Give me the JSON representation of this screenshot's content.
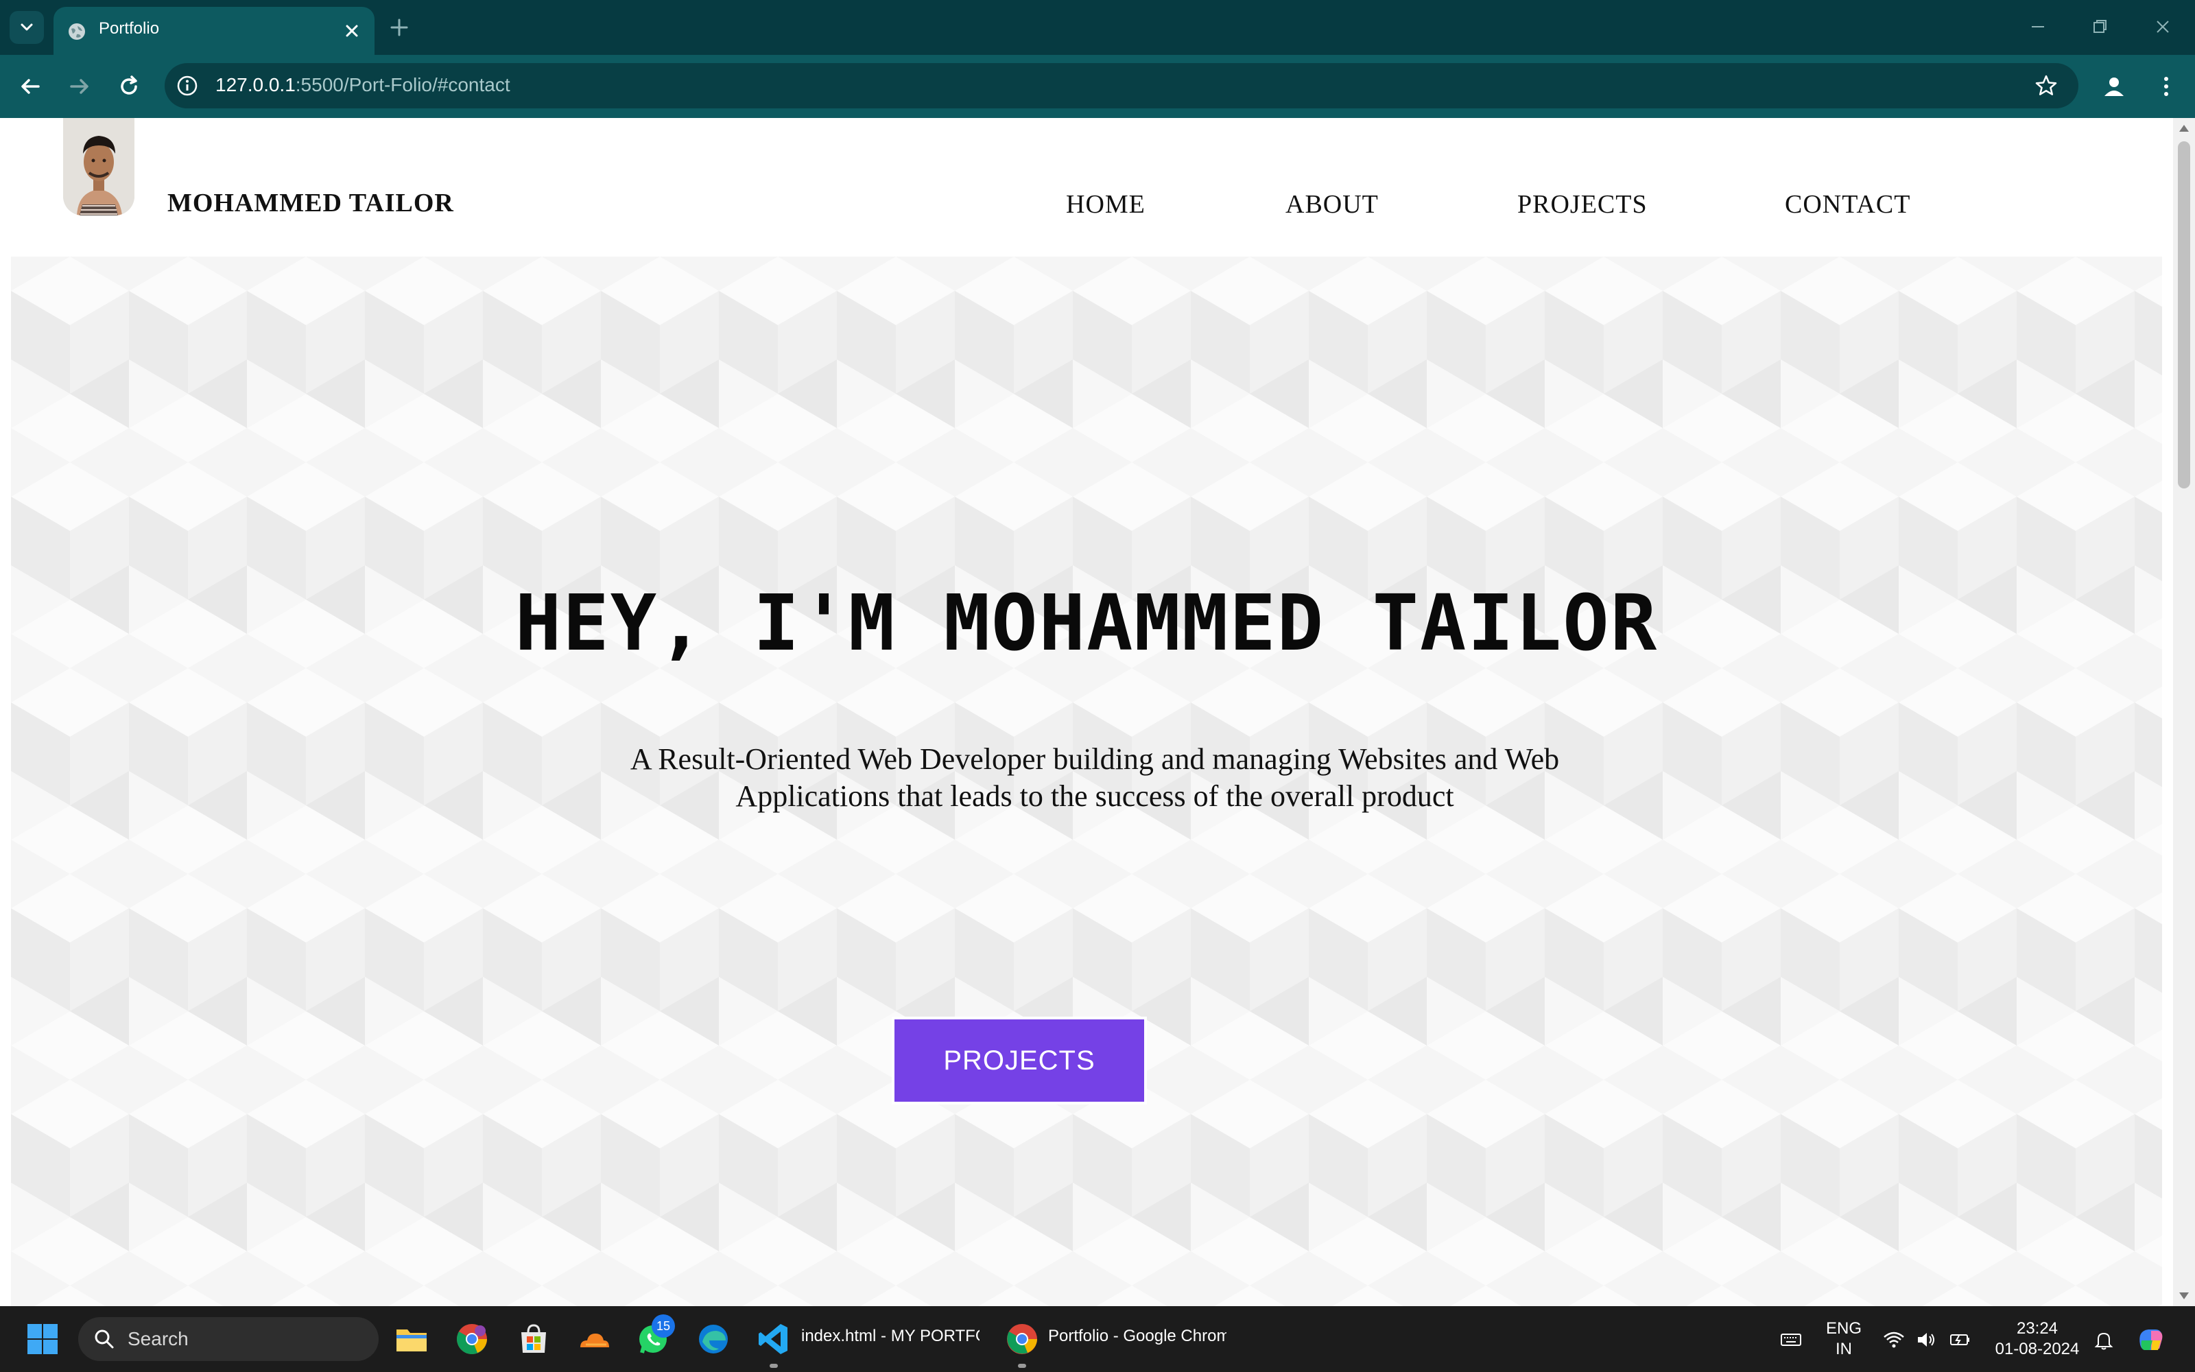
{
  "browser": {
    "tab_title": "Portfolio",
    "url_host": "127.0.0.1",
    "url_path": ":5500/Port-Folio/#contact"
  },
  "site": {
    "brand": "MOHAMMED TAILOR",
    "nav": [
      {
        "label": "HOME"
      },
      {
        "label": "ABOUT"
      },
      {
        "label": "PROJECTS"
      },
      {
        "label": "CONTACT"
      }
    ],
    "hero": {
      "title": "HEY, I'M MOHAMMED TAILOR",
      "subtitle_line1": "A Result-Oriented Web Developer building and managing Websites and Web",
      "subtitle_line2": "Applications that leads to the success of the overall product",
      "cta_label": "PROJECTS"
    },
    "colors": {
      "cta": "#7541e6",
      "browser_frame": "#063a41",
      "toolbar": "#0d5a60"
    }
  },
  "taskbar": {
    "search_placeholder": "Search",
    "whatsapp_badge": "15",
    "vscode_label": "index.html - MY PORTFO",
    "chrome_label": "Portfolio - Google Chrome",
    "lang_line1": "ENG",
    "lang_line2": "IN",
    "time": "23:24",
    "date": "01-08-2024"
  }
}
